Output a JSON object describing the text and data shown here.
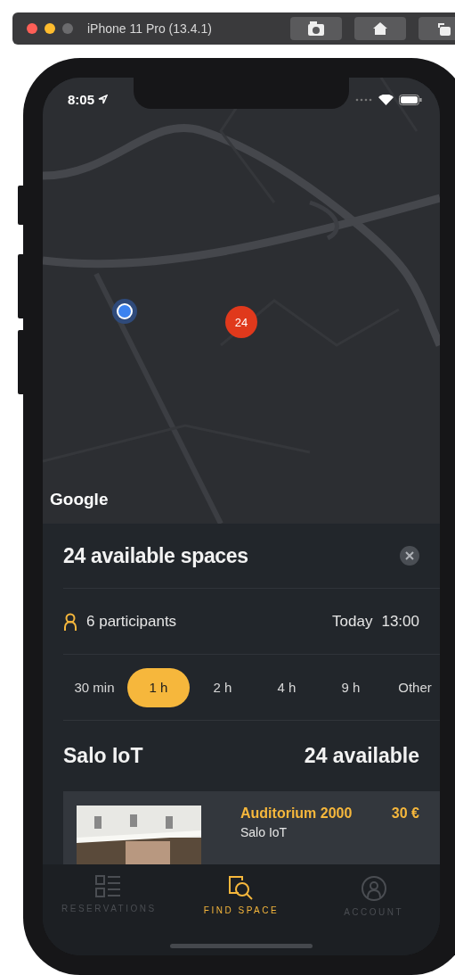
{
  "simulator": {
    "title": "iPhone 11 Pro (13.4.1)"
  },
  "status_bar": {
    "time": "8:05"
  },
  "map": {
    "cluster": "24",
    "attribution": "Google"
  },
  "sheet": {
    "title": "24 available spaces",
    "participants": "6 participants",
    "date": "Today",
    "time": "13:00",
    "durations": [
      {
        "label": "30 min",
        "selected": false
      },
      {
        "label": "1 h",
        "selected": true
      },
      {
        "label": "2 h",
        "selected": false
      },
      {
        "label": "4 h",
        "selected": false
      },
      {
        "label": "9 h",
        "selected": false
      },
      {
        "label": "Other",
        "selected": false
      }
    ],
    "group": {
      "name": "Salo IoT",
      "count": "24 available"
    },
    "spaces": [
      {
        "name": "Auditorium 2000",
        "price": "30 €",
        "location": "Salo IoT"
      }
    ]
  },
  "tab_bar": [
    {
      "label": "RESERVATIONS",
      "kind": "reservations",
      "selected": false
    },
    {
      "label": "FIND SPACE",
      "kind": "find",
      "selected": true
    },
    {
      "label": "ACCOUNT",
      "kind": "account",
      "selected": false
    }
  ]
}
